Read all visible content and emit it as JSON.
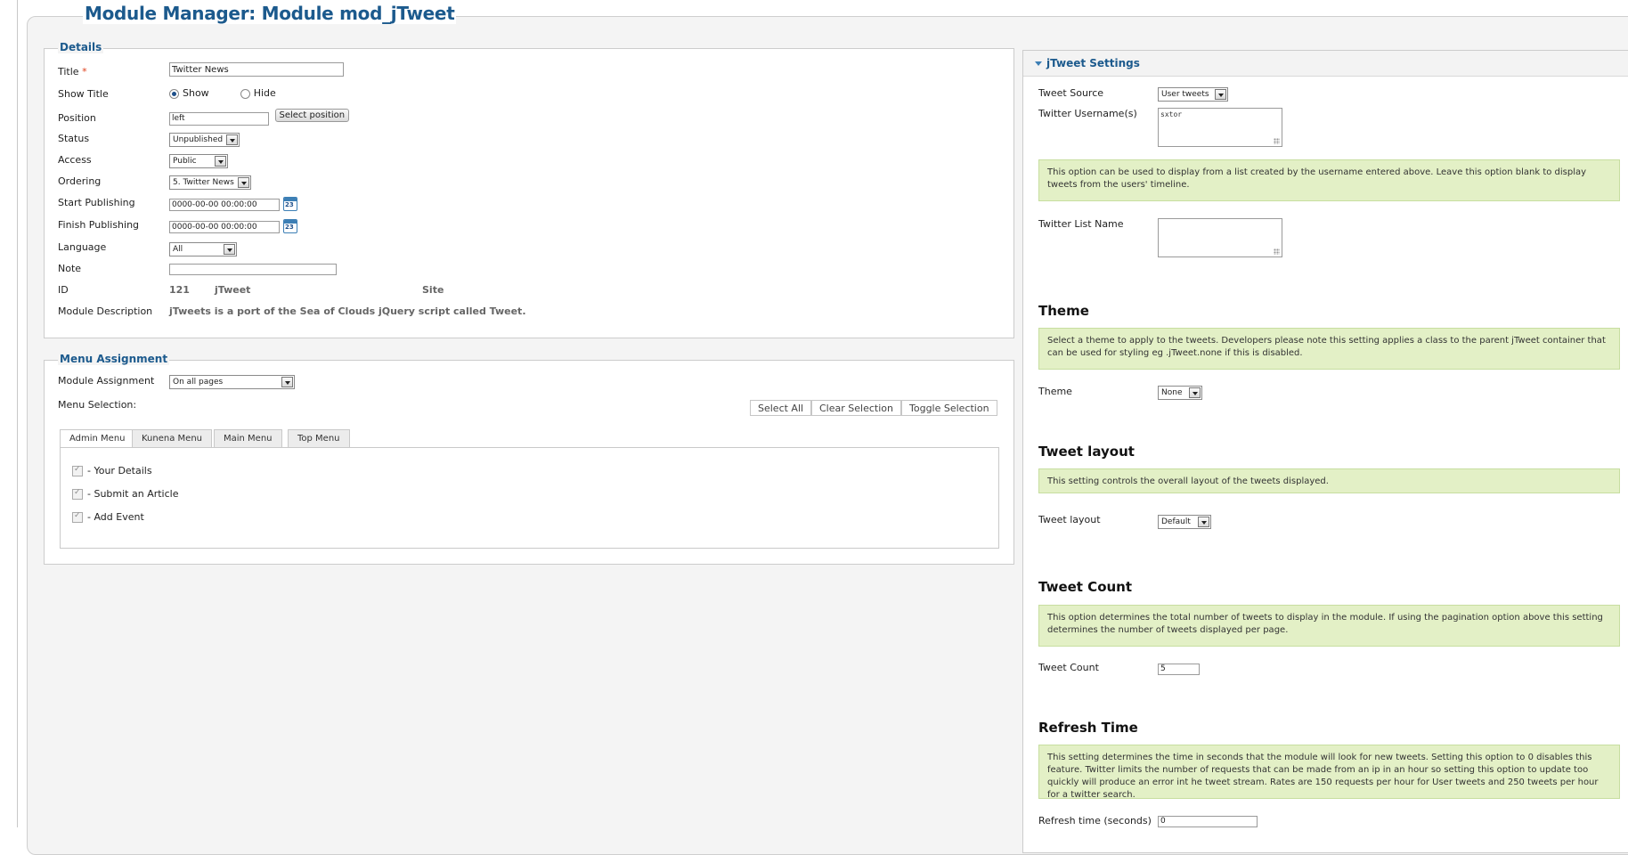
{
  "page": {
    "title": "Module Manager: Module mod_jTweet"
  },
  "details": {
    "legend": "Details",
    "title_label": "Title",
    "title_required": "*",
    "title_value": "Twitter News",
    "show_title_label": "Show Title",
    "show_option": "Show",
    "hide_option": "Hide",
    "position_label": "Position",
    "position_value": "left",
    "select_position_button": "Select position",
    "status_label": "Status",
    "status_value": "Unpublished",
    "access_label": "Access",
    "access_value": "Public",
    "ordering_label": "Ordering",
    "ordering_value": "5. Twitter News",
    "start_label": "Start Publishing",
    "start_value": "0000-00-00 00:00:00",
    "finish_label": "Finish Publishing",
    "finish_value": "0000-00-00 00:00:00",
    "language_label": "Language",
    "language_value": "All",
    "note_label": "Note",
    "note_value": "",
    "id_label": "ID",
    "id_value": "121",
    "module_name": "jTweet",
    "client": "Site",
    "description_label": "Module Description",
    "description_value": "jTweets is a port of the Sea of Clouds jQuery script called Tweet."
  },
  "menu_assignment": {
    "legend": "Menu Assignment",
    "assignment_label": "Module Assignment",
    "assignment_value": "On all pages",
    "selection_label": "Menu Selection:",
    "select_all": "Select All",
    "clear_selection": "Clear Selection",
    "toggle_selection": "Toggle Selection",
    "tabs": [
      "Admin Menu",
      "Kunena Menu",
      "Main Menu",
      "Top Menu"
    ],
    "active_tab": "Admin Menu",
    "items": [
      "- Your Details",
      "- Submit an Article",
      "- Add Event"
    ]
  },
  "settings": {
    "header": "jTweet Settings",
    "tweet_source_label": "Tweet Source",
    "tweet_source_value": "User tweets",
    "usernames_label": "Twitter Username(s)",
    "usernames_value": "sxtor",
    "list_note": "This option can be used to display from a list created by the username entered above. Leave this option blank to display tweets from the users' timeline.",
    "list_name_label": "Twitter List Name",
    "list_name_value": "",
    "theme_heading": "Theme",
    "theme_note": "Select a theme to apply to the tweets. Developers please note this setting applies a class to the parent jTweet container that can be used for styling eg .jTweet.none if this is disabled.",
    "theme_label": "Theme",
    "theme_value": "None",
    "layout_heading": "Tweet layout",
    "layout_note": "This setting controls the overall layout of the tweets displayed.",
    "layout_label": "Tweet layout",
    "layout_value": "Default",
    "count_heading": "Tweet Count",
    "count_note": "This option determines the total number of tweets to display in the module. If using the pagination option above this setting determines the number of tweets displayed per page.",
    "count_label": "Tweet Count",
    "count_value": "5",
    "refresh_heading": "Refresh Time",
    "refresh_note": "This setting determines the time in seconds that the module will look for new tweets. Setting this option to 0 disables this feature. Twitter limits the number of requests that can be made from an ip in an hour so setting this option to update too quickly will produce an error int he tweet stream. Rates are 150 requests per hour for User tweets and 250 tweets per hour for a twitter search.",
    "refresh_label": "Refresh time (seconds)",
    "refresh_value": "0"
  },
  "colors": {
    "title_blue": "#1c5a8d",
    "note_green": "#e3f0c6",
    "input_highlight": "#dbeefe"
  }
}
